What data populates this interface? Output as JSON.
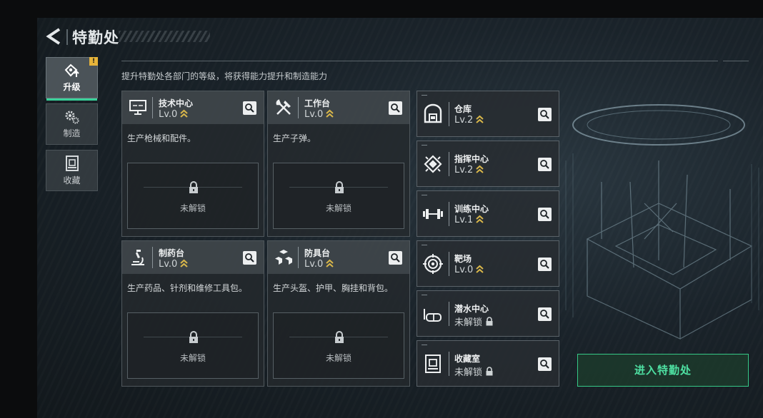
{
  "header": {
    "title": "特勤处"
  },
  "sidebar": {
    "tabs": [
      {
        "label": "升级",
        "icon": "upgrade-icon",
        "active": true,
        "badge": "!"
      },
      {
        "label": "制造",
        "icon": "gears-icon",
        "active": false
      },
      {
        "label": "收藏",
        "icon": "collection-icon",
        "active": false
      }
    ]
  },
  "main": {
    "subtitle": "提升特勤处各部门的等级，将获得能力提升和制造能力",
    "cards": [
      {
        "name": "技术中心",
        "level": "Lv.0",
        "desc": "生产枪械和配件。",
        "status": "未解锁",
        "icon": "computer-icon"
      },
      {
        "name": "工作台",
        "level": "Lv.0",
        "desc": "生产子弹。",
        "status": "未解锁",
        "icon": "tools-icon"
      },
      {
        "name": "制药台",
        "level": "Lv.0",
        "desc": "生产药品、针剂和维修工具包。",
        "status": "未解锁",
        "icon": "microscope-icon"
      },
      {
        "name": "防具台",
        "level": "Lv.0",
        "desc": "生产头盔、护甲、胸挂和背包。",
        "status": "未解锁",
        "icon": "armor-blocks-icon"
      }
    ],
    "side_list": [
      {
        "name": "仓库",
        "level": "Lv.2",
        "icon": "warehouse-icon"
      },
      {
        "name": "指挥中心",
        "level": "Lv.2",
        "icon": "chip-icon"
      },
      {
        "name": "训练中心",
        "level": "Lv.1",
        "icon": "dumbbell-icon"
      },
      {
        "name": "靶场",
        "level": "Lv.0",
        "icon": "target-icon"
      },
      {
        "name": "潜水中心",
        "level": "未解锁",
        "icon": "diving-mask-icon"
      },
      {
        "name": "收藏室",
        "level": "未解锁",
        "icon": "collection-room-icon"
      }
    ]
  },
  "footer": {
    "enter_label": "进入特勤处"
  },
  "colors": {
    "accent": "#39d29a",
    "level_chevron": "#d9b74a",
    "warning": "#e7b43a"
  }
}
